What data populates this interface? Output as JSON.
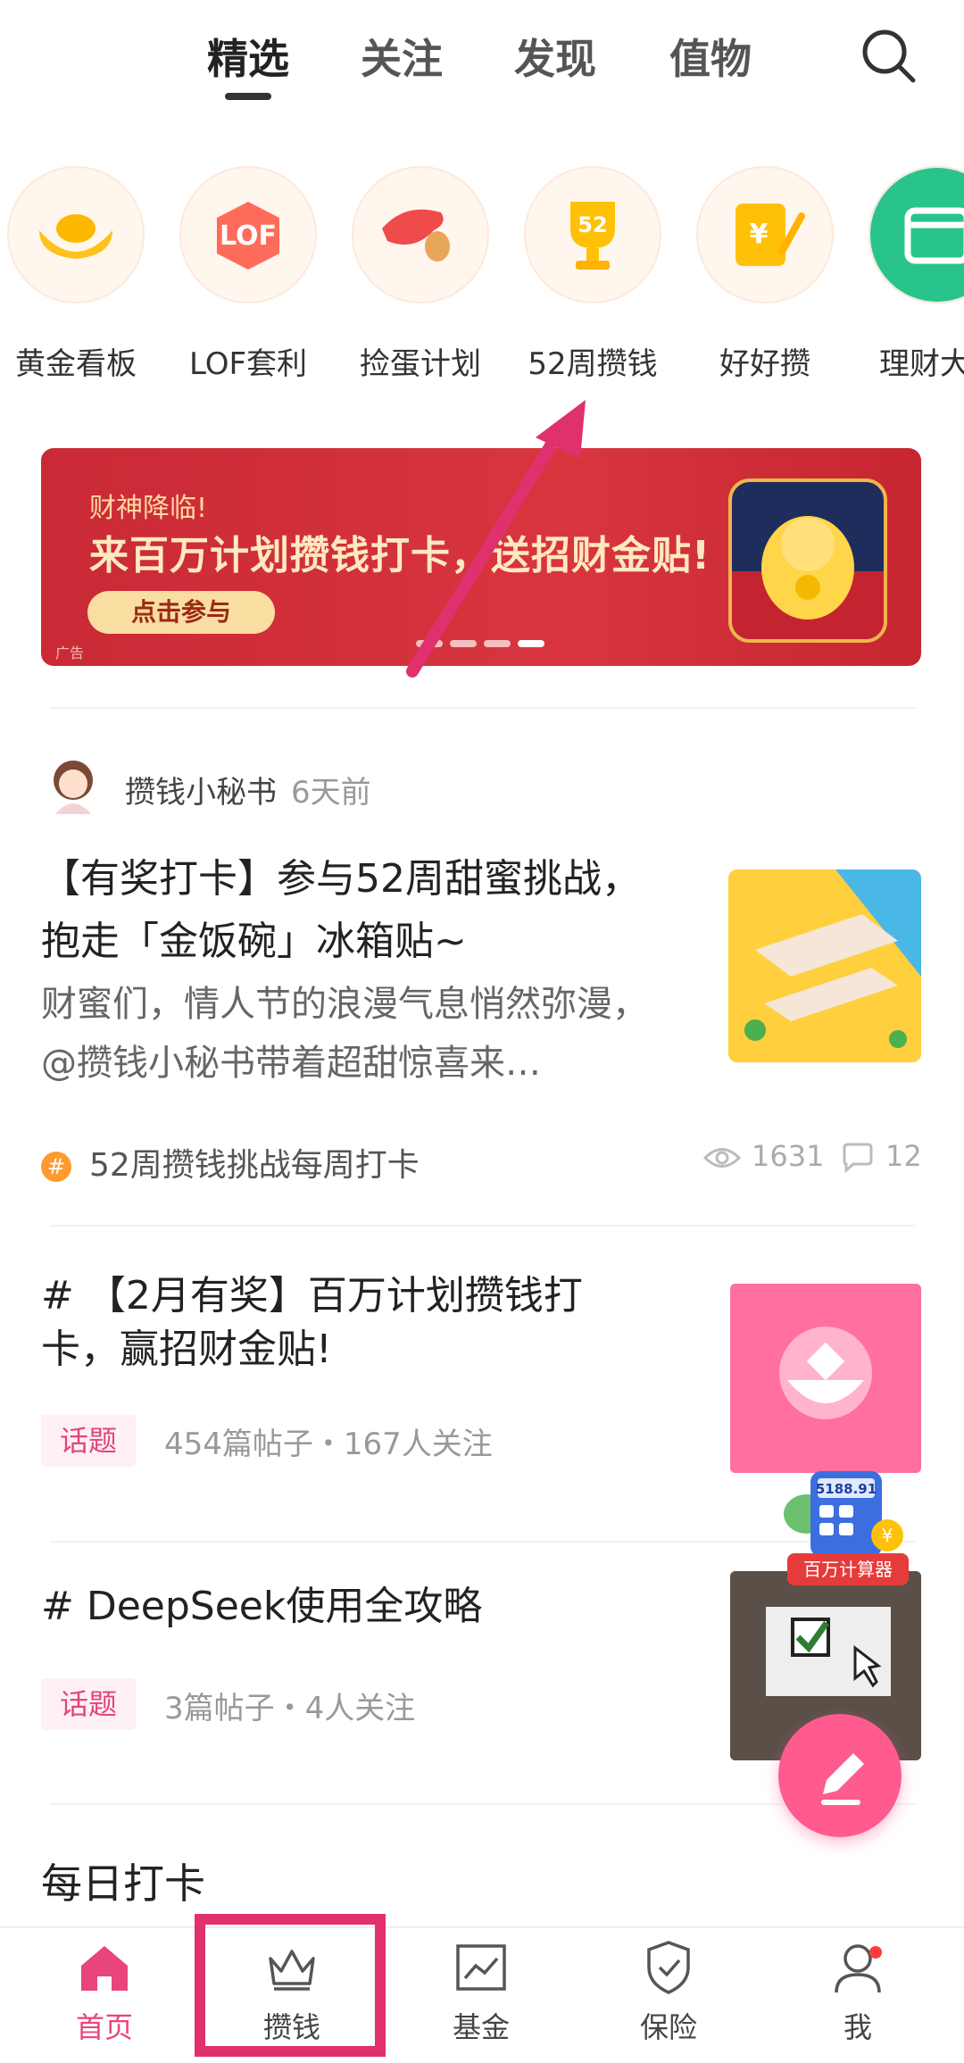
{
  "tabs": [
    {
      "label": "精选",
      "active": true
    },
    {
      "label": "关注",
      "active": false
    },
    {
      "label": "发现",
      "active": false
    },
    {
      "label": "值物",
      "active": false
    }
  ],
  "quick_entries": [
    {
      "label": "黄金看板",
      "icon": "gold-ingot-icon"
    },
    {
      "label": "LOF套利",
      "icon": "lof-hexagon-icon"
    },
    {
      "label": "捡蛋计划",
      "icon": "hand-egg-icon"
    },
    {
      "label": "52周攒钱",
      "icon": "trophy-52-icon"
    },
    {
      "label": "好好攒",
      "icon": "yen-note-icon"
    },
    {
      "label": "理财大",
      "icon": "wallet-icon"
    }
  ],
  "banner": {
    "subtitle": "财神降临!",
    "title": "来百万计划攒钱打卡，送招财金贴!",
    "button": "点击参与",
    "ad_label": "广告",
    "dots": 4,
    "active_dot": 3
  },
  "post": {
    "author": "攒钱小秘书",
    "time": "6天前",
    "title": "【有奖打卡】参与52周甜蜜挑战，抱走「金饭碗」冰箱贴~",
    "desc": "财蜜们，情人节的浪漫气息悄然弥漫，@攒钱小秘书带着超甜惊喜来…",
    "topic": "52周攒钱挑战每周打卡",
    "views": "1631",
    "comments": "12"
  },
  "topics": [
    {
      "title": "# 【2月有奖】百万计划攒钱打卡，赢招财金贴!",
      "badge": "话题",
      "meta": "454篇帖子・167人关注"
    },
    {
      "title": "# DeepSeek使用全攻略",
      "badge": "话题",
      "meta": "3篇帖子・4人关注"
    }
  ],
  "daily": "每日打卡",
  "floating": {
    "calc_label": "百万计算器",
    "calc_number": "5188.91"
  },
  "bottom_nav": [
    {
      "label": "首页",
      "active": true
    },
    {
      "label": "攒钱",
      "active": false
    },
    {
      "label": "基金",
      "active": false
    },
    {
      "label": "保险",
      "active": false
    },
    {
      "label": "我",
      "active": false
    }
  ],
  "colors": {
    "accent": "#e8457c",
    "annotation": "#e0306d",
    "banner": "#d8353f"
  }
}
